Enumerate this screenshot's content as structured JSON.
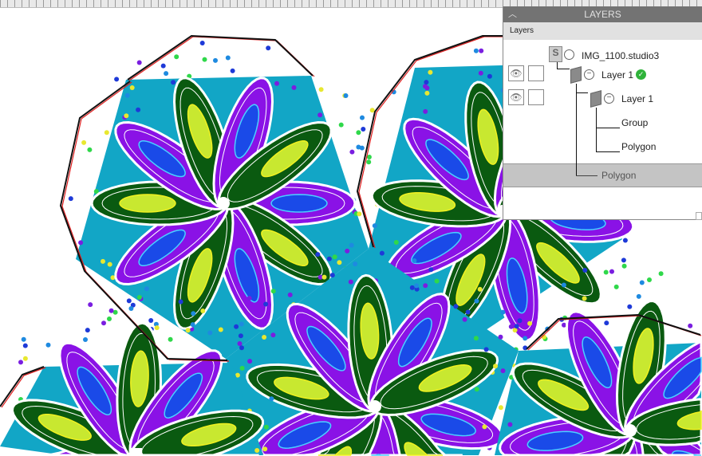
{
  "panel": {
    "title": "LAYERS",
    "subheader": "Layers",
    "tree": [
      {
        "label": "IMG_1100.studio3",
        "type": "document"
      },
      {
        "label": "Layer 1",
        "type": "layer",
        "status": "active"
      },
      {
        "label": "Layer 1",
        "type": "layer"
      },
      {
        "label": "Group",
        "type": "object"
      },
      {
        "label": "Polygon",
        "type": "object"
      },
      {
        "label": "Polygon",
        "type": "object",
        "selected": true
      }
    ],
    "icons": {
      "collapse": "chevron-up-icon",
      "visibility": "eye-icon",
      "active": "checkmark-icon"
    }
  },
  "colors": {
    "teal": "#12a6c6",
    "purple": "#8a12e6",
    "green": "#0a5a10",
    "accent": "#2fb33a"
  }
}
